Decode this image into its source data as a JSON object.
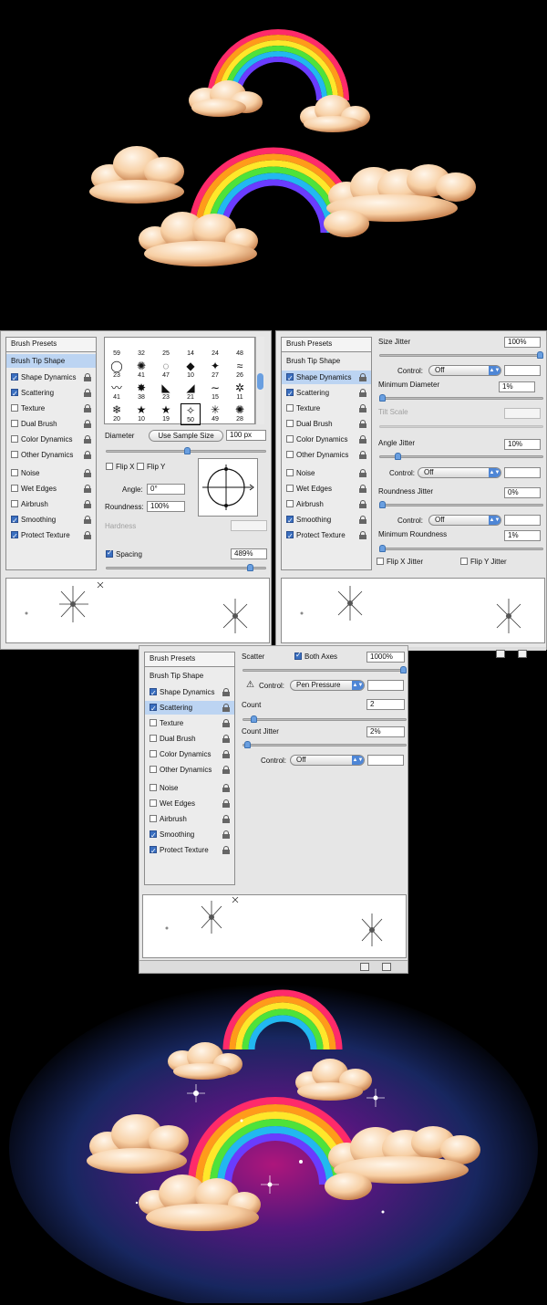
{
  "panel_left": {
    "presets_header": "Brush Presets",
    "items": [
      {
        "label": "Brush Tip Shape",
        "checkbox": false,
        "checked": false,
        "lock": false,
        "selected": true
      },
      {
        "label": "Shape Dynamics",
        "checkbox": true,
        "checked": true,
        "lock": true,
        "selected": false
      },
      {
        "label": "Scattering",
        "checkbox": true,
        "checked": true,
        "lock": true,
        "selected": false
      },
      {
        "label": "Texture",
        "checkbox": true,
        "checked": false,
        "lock": true,
        "selected": false
      },
      {
        "label": "Dual Brush",
        "checkbox": true,
        "checked": false,
        "lock": true,
        "selected": false
      },
      {
        "label": "Color Dynamics",
        "checkbox": true,
        "checked": false,
        "lock": true,
        "selected": false
      },
      {
        "label": "Other Dynamics",
        "checkbox": true,
        "checked": false,
        "lock": true,
        "selected": false
      },
      {
        "label": "Noise",
        "checkbox": true,
        "checked": false,
        "lock": true,
        "selected": false
      },
      {
        "label": "Wet Edges",
        "checkbox": true,
        "checked": false,
        "lock": true,
        "selected": false
      },
      {
        "label": "Airbrush",
        "checkbox": true,
        "checked": false,
        "lock": true,
        "selected": false
      },
      {
        "label": "Smoothing",
        "checkbox": true,
        "checked": true,
        "lock": true,
        "selected": false
      },
      {
        "label": "Protect Texture",
        "checkbox": true,
        "checked": true,
        "lock": true,
        "selected": false
      }
    ],
    "tips": [
      {
        "glyph": "",
        "size": "59"
      },
      {
        "glyph": "",
        "size": "32"
      },
      {
        "glyph": "",
        "size": "25"
      },
      {
        "glyph": "",
        "size": "14"
      },
      {
        "glyph": "",
        "size": "24"
      },
      {
        "glyph": "",
        "size": "48"
      },
      {
        "glyph": "◯",
        "size": "23"
      },
      {
        "glyph": "✺",
        "size": "41"
      },
      {
        "glyph": "◌",
        "size": "47"
      },
      {
        "glyph": "◆",
        "size": "10"
      },
      {
        "glyph": "✦",
        "size": "27"
      },
      {
        "glyph": "≈",
        "size": "26"
      },
      {
        "glyph": "〰",
        "size": "41"
      },
      {
        "glyph": "✸",
        "size": "38"
      },
      {
        "glyph": "◣",
        "size": "23"
      },
      {
        "glyph": "◢",
        "size": "21"
      },
      {
        "glyph": "∼",
        "size": "15"
      },
      {
        "glyph": "✲",
        "size": "11"
      },
      {
        "glyph": "❄",
        "size": "20"
      },
      {
        "glyph": "★",
        "size": "10"
      },
      {
        "glyph": "★",
        "size": "19"
      },
      {
        "glyph": "✧",
        "size": "50"
      },
      {
        "glyph": "✳",
        "size": "49"
      },
      {
        "glyph": "✺",
        "size": "28"
      }
    ],
    "diameter_label": "Diameter",
    "use_sample_size": "Use Sample Size",
    "diameter_value": "100 px",
    "flip_x": "Flip X",
    "flip_y": "Flip Y",
    "angle_label": "Angle:",
    "angle_value": "0°",
    "roundness_label": "Roundness:",
    "roundness_value": "100%",
    "hardness_label": "Hardness",
    "spacing_label": "Spacing",
    "spacing_value": "489%"
  },
  "panel_right": {
    "presets_header": "Brush Presets",
    "size_jitter_label": "Size Jitter",
    "size_jitter_value": "100%",
    "control_label": "Control:",
    "control_off": "Off",
    "min_diameter_label": "Minimum Diameter",
    "min_diameter_value": "1%",
    "tilt_scale_label": "Tilt Scale",
    "angle_jitter_label": "Angle Jitter",
    "angle_jitter_value": "10%",
    "roundness_jitter_label": "Roundness Jitter",
    "roundness_jitter_value": "0%",
    "min_roundness_label": "Minimum Roundness",
    "min_roundness_value": "1%",
    "flip_x_jitter": "Flip X Jitter",
    "flip_y_jitter": "Flip Y Jitter"
  },
  "panel_scatter": {
    "presets_header": "Brush Presets",
    "scatter_label": "Scatter",
    "both_axes_label": "Both Axes",
    "scatter_value": "1000%",
    "control_label": "Control:",
    "control_pen": "Pen Pressure",
    "count_label": "Count",
    "count_value": "2",
    "count_jitter_label": "Count Jitter",
    "count_jitter_value": "2%",
    "control_off": "Off"
  },
  "colors": {
    "black": "#000000",
    "accent_blue": "#4e86d6",
    "selection": "#bcd4f2"
  },
  "sliders": {
    "diameter": 0.4,
    "spacing": 0.89,
    "size_jitter": 1.0,
    "min_diameter": 0.01,
    "angle_jitter": 0.1,
    "roundness_jitter": 0.0,
    "min_roundness": 0.01,
    "scatter": 1.0,
    "count": 0.06,
    "count_jitter": 0.02
  }
}
